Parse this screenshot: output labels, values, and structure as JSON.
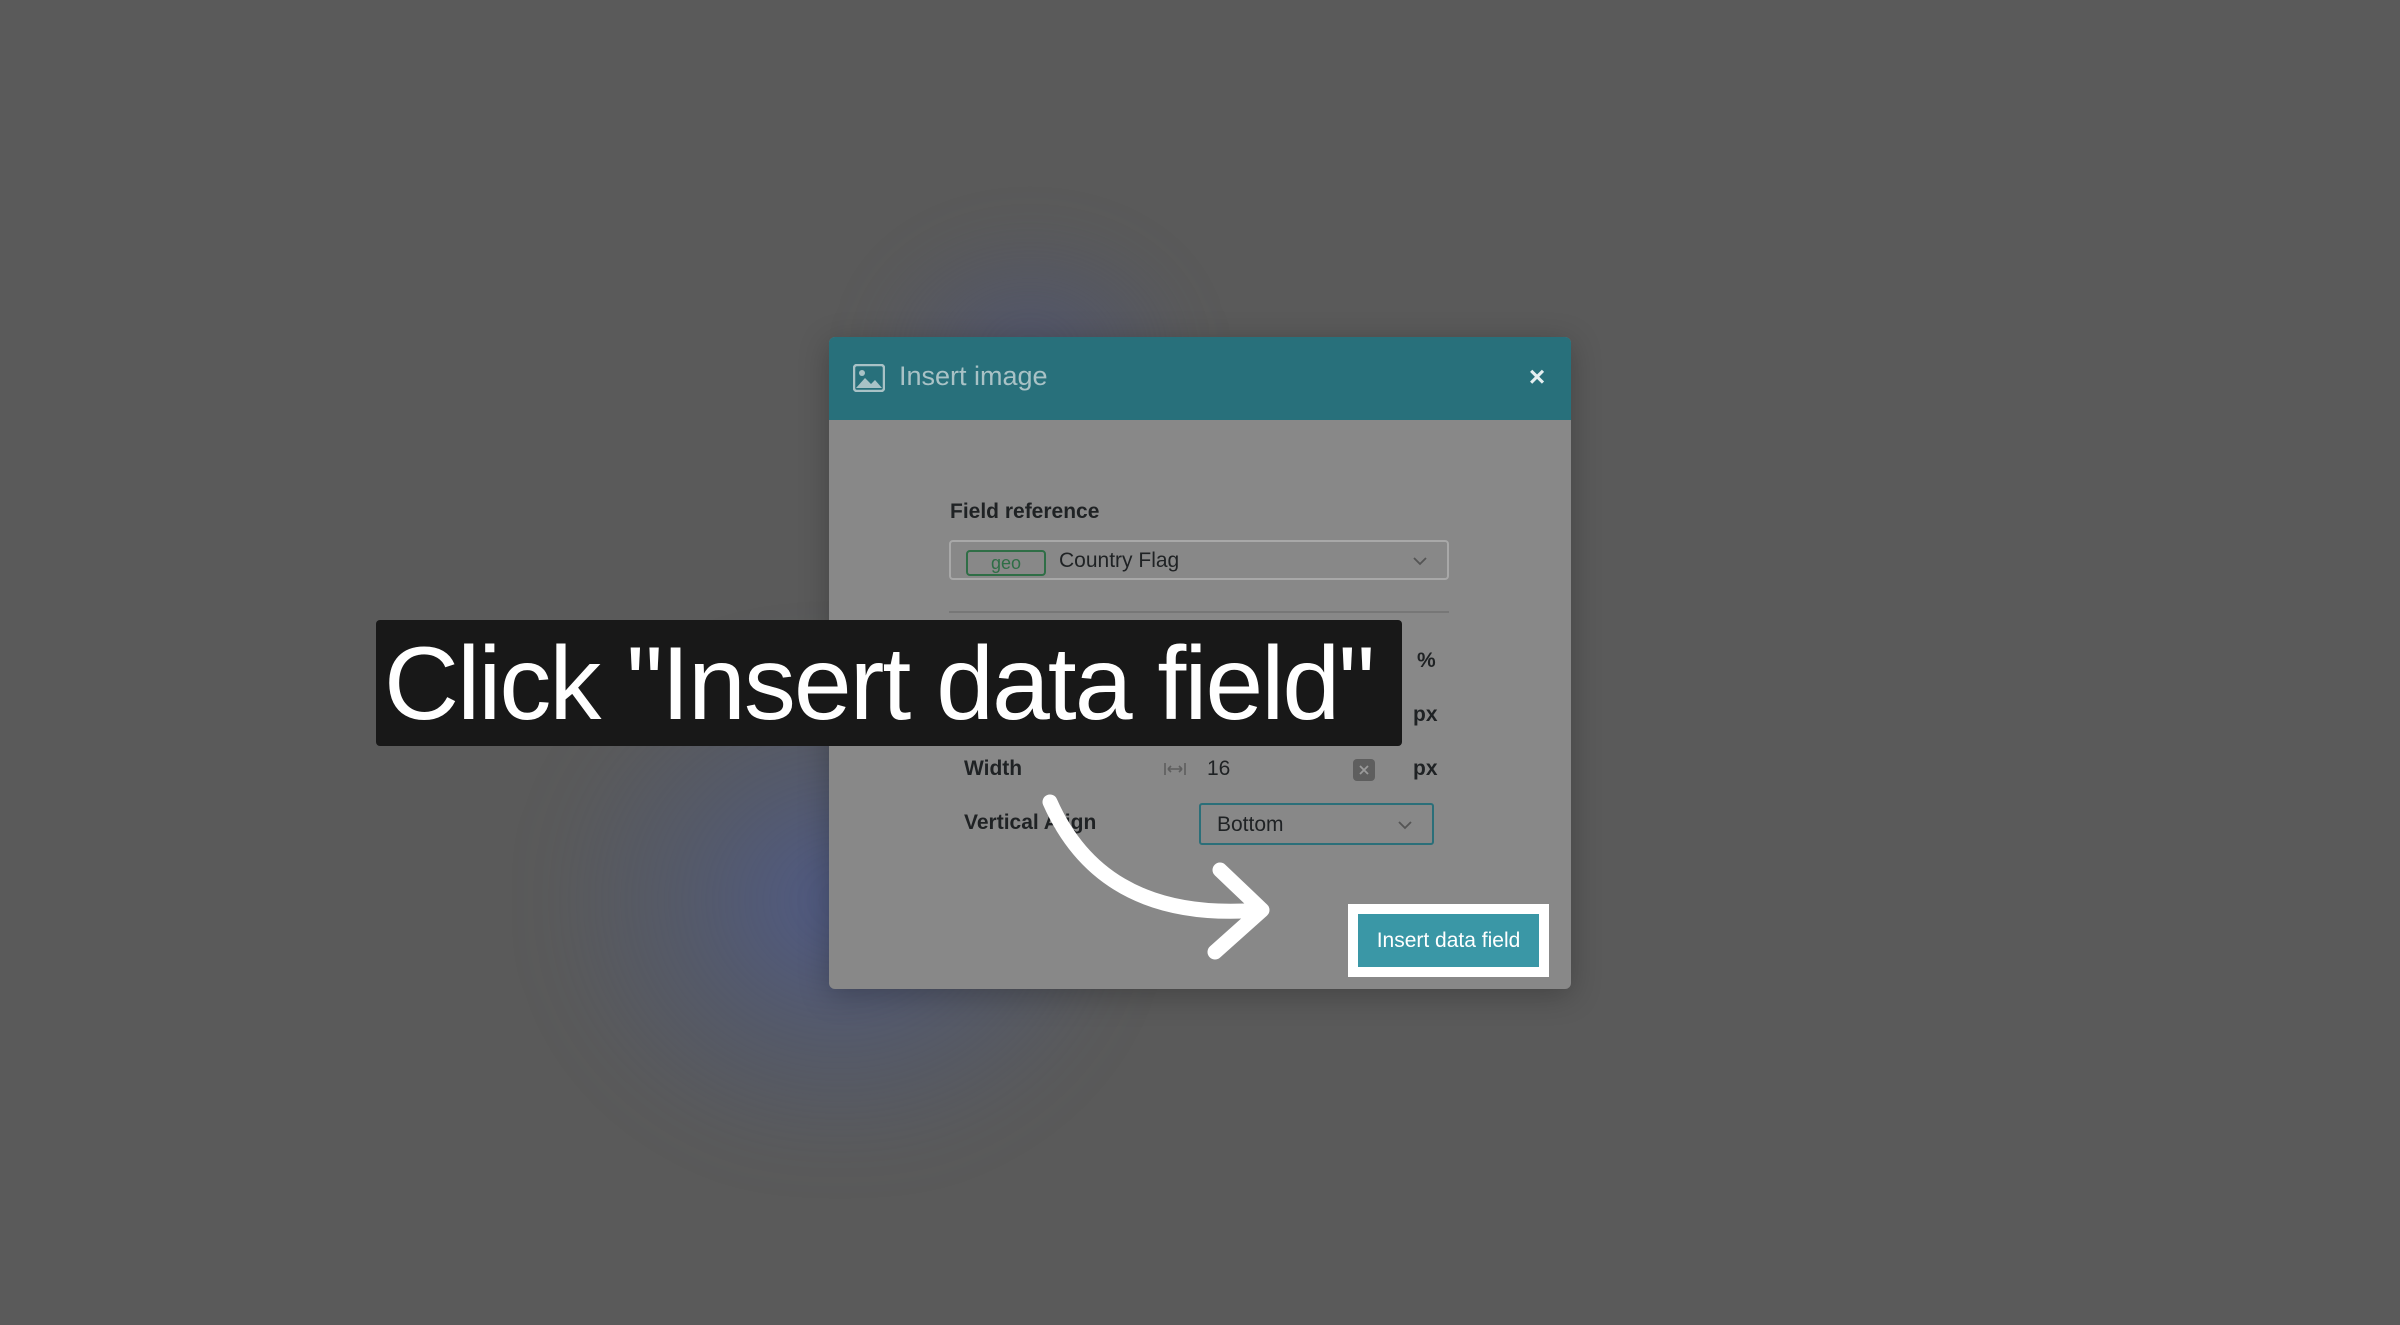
{
  "dialog": {
    "title": "Insert image",
    "close_label": "×",
    "field_reference_label": "Field reference",
    "field_reference": {
      "tag": "geo",
      "value": "Country Flag"
    },
    "rows": {
      "first_unit": "%",
      "second_unit": "px",
      "width_label": "Width",
      "width_value": "16",
      "width_unit": "px",
      "vertical_align_label": "Vertical Align",
      "vertical_align_value": "Bottom"
    },
    "insert_button_label": "Insert data field"
  },
  "callout": {
    "text": "Click \"Insert data field\""
  },
  "colors": {
    "header": "#28707b",
    "button": "#3a97a6",
    "tag": "#2f6e46"
  }
}
